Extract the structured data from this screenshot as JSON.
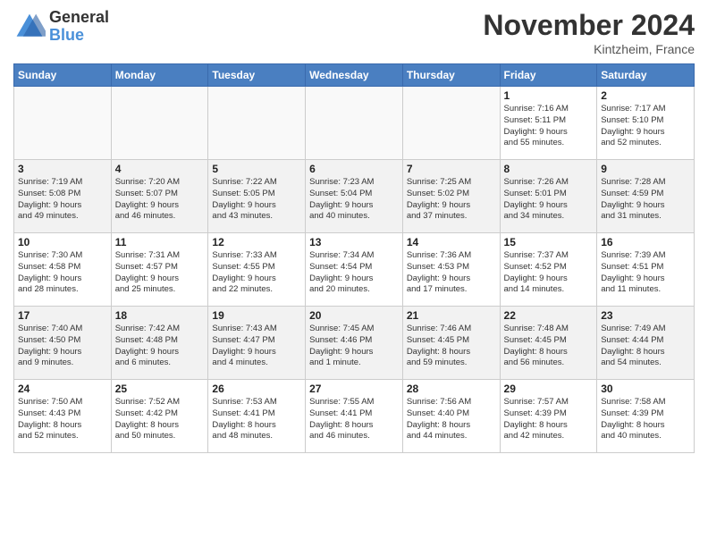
{
  "logo": {
    "line1": "General",
    "line2": "Blue"
  },
  "title": "November 2024",
  "location": "Kintzheim, France",
  "weekdays": [
    "Sunday",
    "Monday",
    "Tuesday",
    "Wednesday",
    "Thursday",
    "Friday",
    "Saturday"
  ],
  "weeks": [
    [
      {
        "day": "",
        "info": ""
      },
      {
        "day": "",
        "info": ""
      },
      {
        "day": "",
        "info": ""
      },
      {
        "day": "",
        "info": ""
      },
      {
        "day": "",
        "info": ""
      },
      {
        "day": "1",
        "info": "Sunrise: 7:16 AM\nSunset: 5:11 PM\nDaylight: 9 hours\nand 55 minutes."
      },
      {
        "day": "2",
        "info": "Sunrise: 7:17 AM\nSunset: 5:10 PM\nDaylight: 9 hours\nand 52 minutes."
      }
    ],
    [
      {
        "day": "3",
        "info": "Sunrise: 7:19 AM\nSunset: 5:08 PM\nDaylight: 9 hours\nand 49 minutes."
      },
      {
        "day": "4",
        "info": "Sunrise: 7:20 AM\nSunset: 5:07 PM\nDaylight: 9 hours\nand 46 minutes."
      },
      {
        "day": "5",
        "info": "Sunrise: 7:22 AM\nSunset: 5:05 PM\nDaylight: 9 hours\nand 43 minutes."
      },
      {
        "day": "6",
        "info": "Sunrise: 7:23 AM\nSunset: 5:04 PM\nDaylight: 9 hours\nand 40 minutes."
      },
      {
        "day": "7",
        "info": "Sunrise: 7:25 AM\nSunset: 5:02 PM\nDaylight: 9 hours\nand 37 minutes."
      },
      {
        "day": "8",
        "info": "Sunrise: 7:26 AM\nSunset: 5:01 PM\nDaylight: 9 hours\nand 34 minutes."
      },
      {
        "day": "9",
        "info": "Sunrise: 7:28 AM\nSunset: 4:59 PM\nDaylight: 9 hours\nand 31 minutes."
      }
    ],
    [
      {
        "day": "10",
        "info": "Sunrise: 7:30 AM\nSunset: 4:58 PM\nDaylight: 9 hours\nand 28 minutes."
      },
      {
        "day": "11",
        "info": "Sunrise: 7:31 AM\nSunset: 4:57 PM\nDaylight: 9 hours\nand 25 minutes."
      },
      {
        "day": "12",
        "info": "Sunrise: 7:33 AM\nSunset: 4:55 PM\nDaylight: 9 hours\nand 22 minutes."
      },
      {
        "day": "13",
        "info": "Sunrise: 7:34 AM\nSunset: 4:54 PM\nDaylight: 9 hours\nand 20 minutes."
      },
      {
        "day": "14",
        "info": "Sunrise: 7:36 AM\nSunset: 4:53 PM\nDaylight: 9 hours\nand 17 minutes."
      },
      {
        "day": "15",
        "info": "Sunrise: 7:37 AM\nSunset: 4:52 PM\nDaylight: 9 hours\nand 14 minutes."
      },
      {
        "day": "16",
        "info": "Sunrise: 7:39 AM\nSunset: 4:51 PM\nDaylight: 9 hours\nand 11 minutes."
      }
    ],
    [
      {
        "day": "17",
        "info": "Sunrise: 7:40 AM\nSunset: 4:50 PM\nDaylight: 9 hours\nand 9 minutes."
      },
      {
        "day": "18",
        "info": "Sunrise: 7:42 AM\nSunset: 4:48 PM\nDaylight: 9 hours\nand 6 minutes."
      },
      {
        "day": "19",
        "info": "Sunrise: 7:43 AM\nSunset: 4:47 PM\nDaylight: 9 hours\nand 4 minutes."
      },
      {
        "day": "20",
        "info": "Sunrise: 7:45 AM\nSunset: 4:46 PM\nDaylight: 9 hours\nand 1 minute."
      },
      {
        "day": "21",
        "info": "Sunrise: 7:46 AM\nSunset: 4:45 PM\nDaylight: 8 hours\nand 59 minutes."
      },
      {
        "day": "22",
        "info": "Sunrise: 7:48 AM\nSunset: 4:45 PM\nDaylight: 8 hours\nand 56 minutes."
      },
      {
        "day": "23",
        "info": "Sunrise: 7:49 AM\nSunset: 4:44 PM\nDaylight: 8 hours\nand 54 minutes."
      }
    ],
    [
      {
        "day": "24",
        "info": "Sunrise: 7:50 AM\nSunset: 4:43 PM\nDaylight: 8 hours\nand 52 minutes."
      },
      {
        "day": "25",
        "info": "Sunrise: 7:52 AM\nSunset: 4:42 PM\nDaylight: 8 hours\nand 50 minutes."
      },
      {
        "day": "26",
        "info": "Sunrise: 7:53 AM\nSunset: 4:41 PM\nDaylight: 8 hours\nand 48 minutes."
      },
      {
        "day": "27",
        "info": "Sunrise: 7:55 AM\nSunset: 4:41 PM\nDaylight: 8 hours\nand 46 minutes."
      },
      {
        "day": "28",
        "info": "Sunrise: 7:56 AM\nSunset: 4:40 PM\nDaylight: 8 hours\nand 44 minutes."
      },
      {
        "day": "29",
        "info": "Sunrise: 7:57 AM\nSunset: 4:39 PM\nDaylight: 8 hours\nand 42 minutes."
      },
      {
        "day": "30",
        "info": "Sunrise: 7:58 AM\nSunset: 4:39 PM\nDaylight: 8 hours\nand 40 minutes."
      }
    ]
  ]
}
